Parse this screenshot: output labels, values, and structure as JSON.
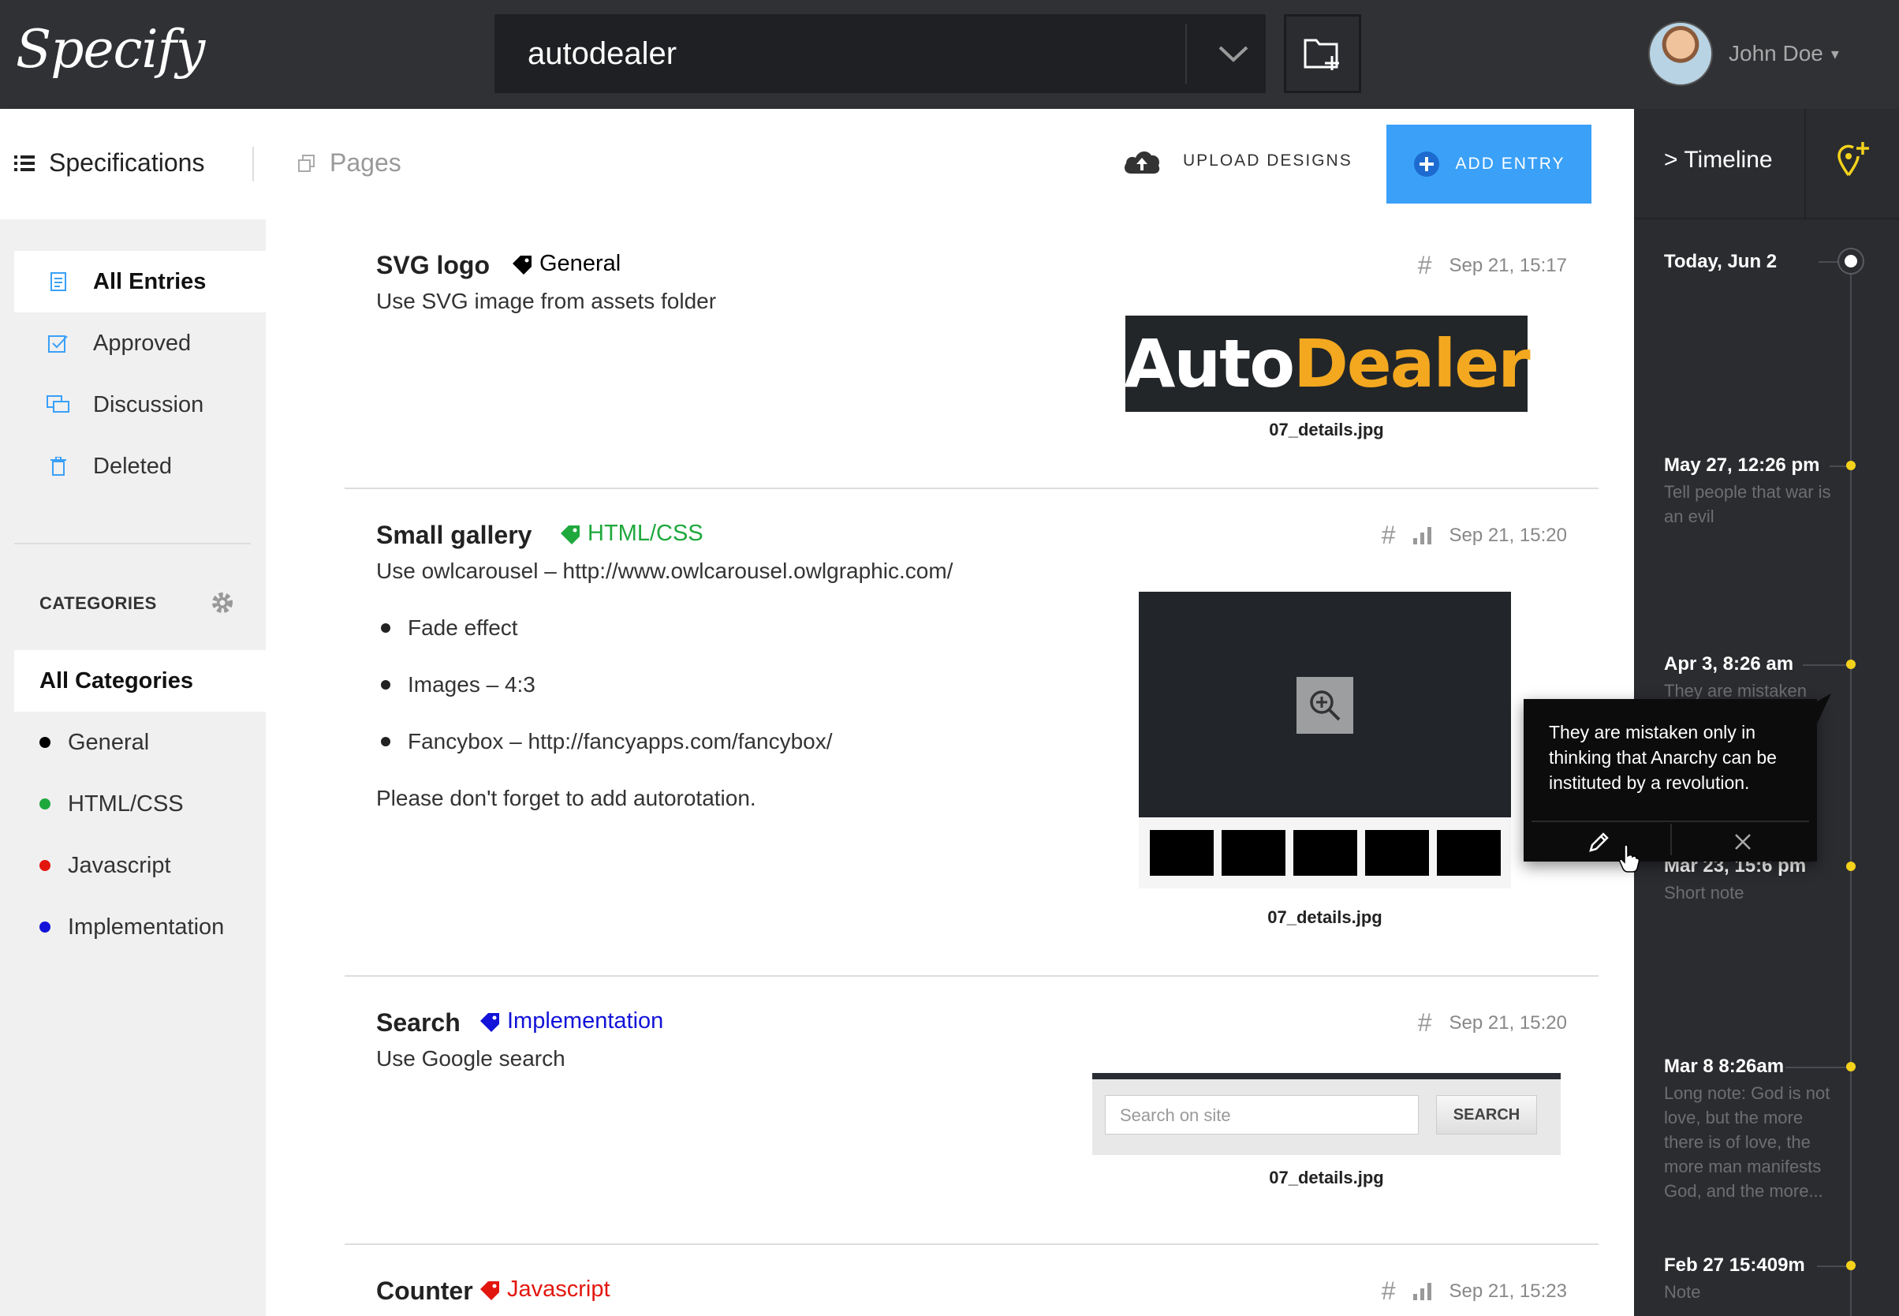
{
  "app": {
    "logo": "Specify"
  },
  "project_select": {
    "value": "autodealer"
  },
  "user": {
    "name": "John Doe"
  },
  "subnav": {
    "specifications_label": "Specifications",
    "pages_label": "Pages",
    "upload_label": "UPLOAD DESIGNS",
    "add_entry_label": "ADD ENTRY"
  },
  "sidebar": {
    "items": [
      {
        "label": "All Entries",
        "icon": "entries-icon"
      },
      {
        "label": "Approved",
        "icon": "approved-icon"
      },
      {
        "label": "Discussion",
        "icon": "discussion-icon"
      },
      {
        "label": "Deleted",
        "icon": "trash-icon"
      }
    ],
    "categories_title": "CATEGORIES",
    "categories": [
      {
        "label": "All Categories"
      },
      {
        "label": "General",
        "color": "#000000"
      },
      {
        "label": "HTML/CSS",
        "color": "#1fa83c"
      },
      {
        "label": "Javascript",
        "color": "#e3160e"
      },
      {
        "label": "Implementation",
        "color": "#1212d8"
      }
    ]
  },
  "entries": [
    {
      "title": "SVG logo",
      "tag": "General",
      "tag_color": "#000000",
      "date": "Sep 21, 15:17",
      "lines": [
        "Use SVG image from assets folder"
      ],
      "image_text_1": "Auto",
      "image_text_2": "Dealer",
      "filename": "07_details.jpg"
    },
    {
      "title": "Small gallery",
      "tag": "HTML/CSS",
      "tag_color": "#1fa83c",
      "date": "Sep 21, 15:20",
      "lines": [
        "Use owlcarousel – http://www.owlcarousel.owlgraphic.com/",
        "Fade effect",
        "Images – 4:3",
        "Fancybox – http://fancyapps.com/fancybox/",
        "Please don't forget to add autorotation."
      ],
      "filename": "07_details.jpg"
    },
    {
      "title": "Search",
      "tag": "Implementation",
      "tag_color": "#1212d8",
      "date": "Sep 21, 15:20",
      "lines": [
        "Use Google search"
      ],
      "search_placeholder": "Search on site",
      "search_button": "SEARCH",
      "filename": "07_details.jpg"
    },
    {
      "title": "Counter",
      "tag": "Javascript",
      "tag_color": "#e3160e",
      "date": "Sep 21, 15:23"
    }
  ],
  "timeline": {
    "title": "> Timeline",
    "items": [
      {
        "date": "Today, Jun 2",
        "note": ""
      },
      {
        "date": "May 27, 12:26 pm",
        "note": "Tell people that war is an evil"
      },
      {
        "date": "Apr 3, 8:26 am",
        "note": "They are mistaken"
      },
      {
        "date": "Mar 23, 15:6 pm",
        "note": "Short note"
      },
      {
        "date": "Mar 8 8:26am",
        "note": "Long note: God is not love, but the more there is of love, the more man manifests God, and the more..."
      },
      {
        "date": "Feb 27 15:409m",
        "note": "Note"
      }
    ],
    "accent_color": "#f4d21c"
  },
  "popover": {
    "text": "They are mistaken only in thinking that Anarchy can be instituted by a revolution."
  }
}
